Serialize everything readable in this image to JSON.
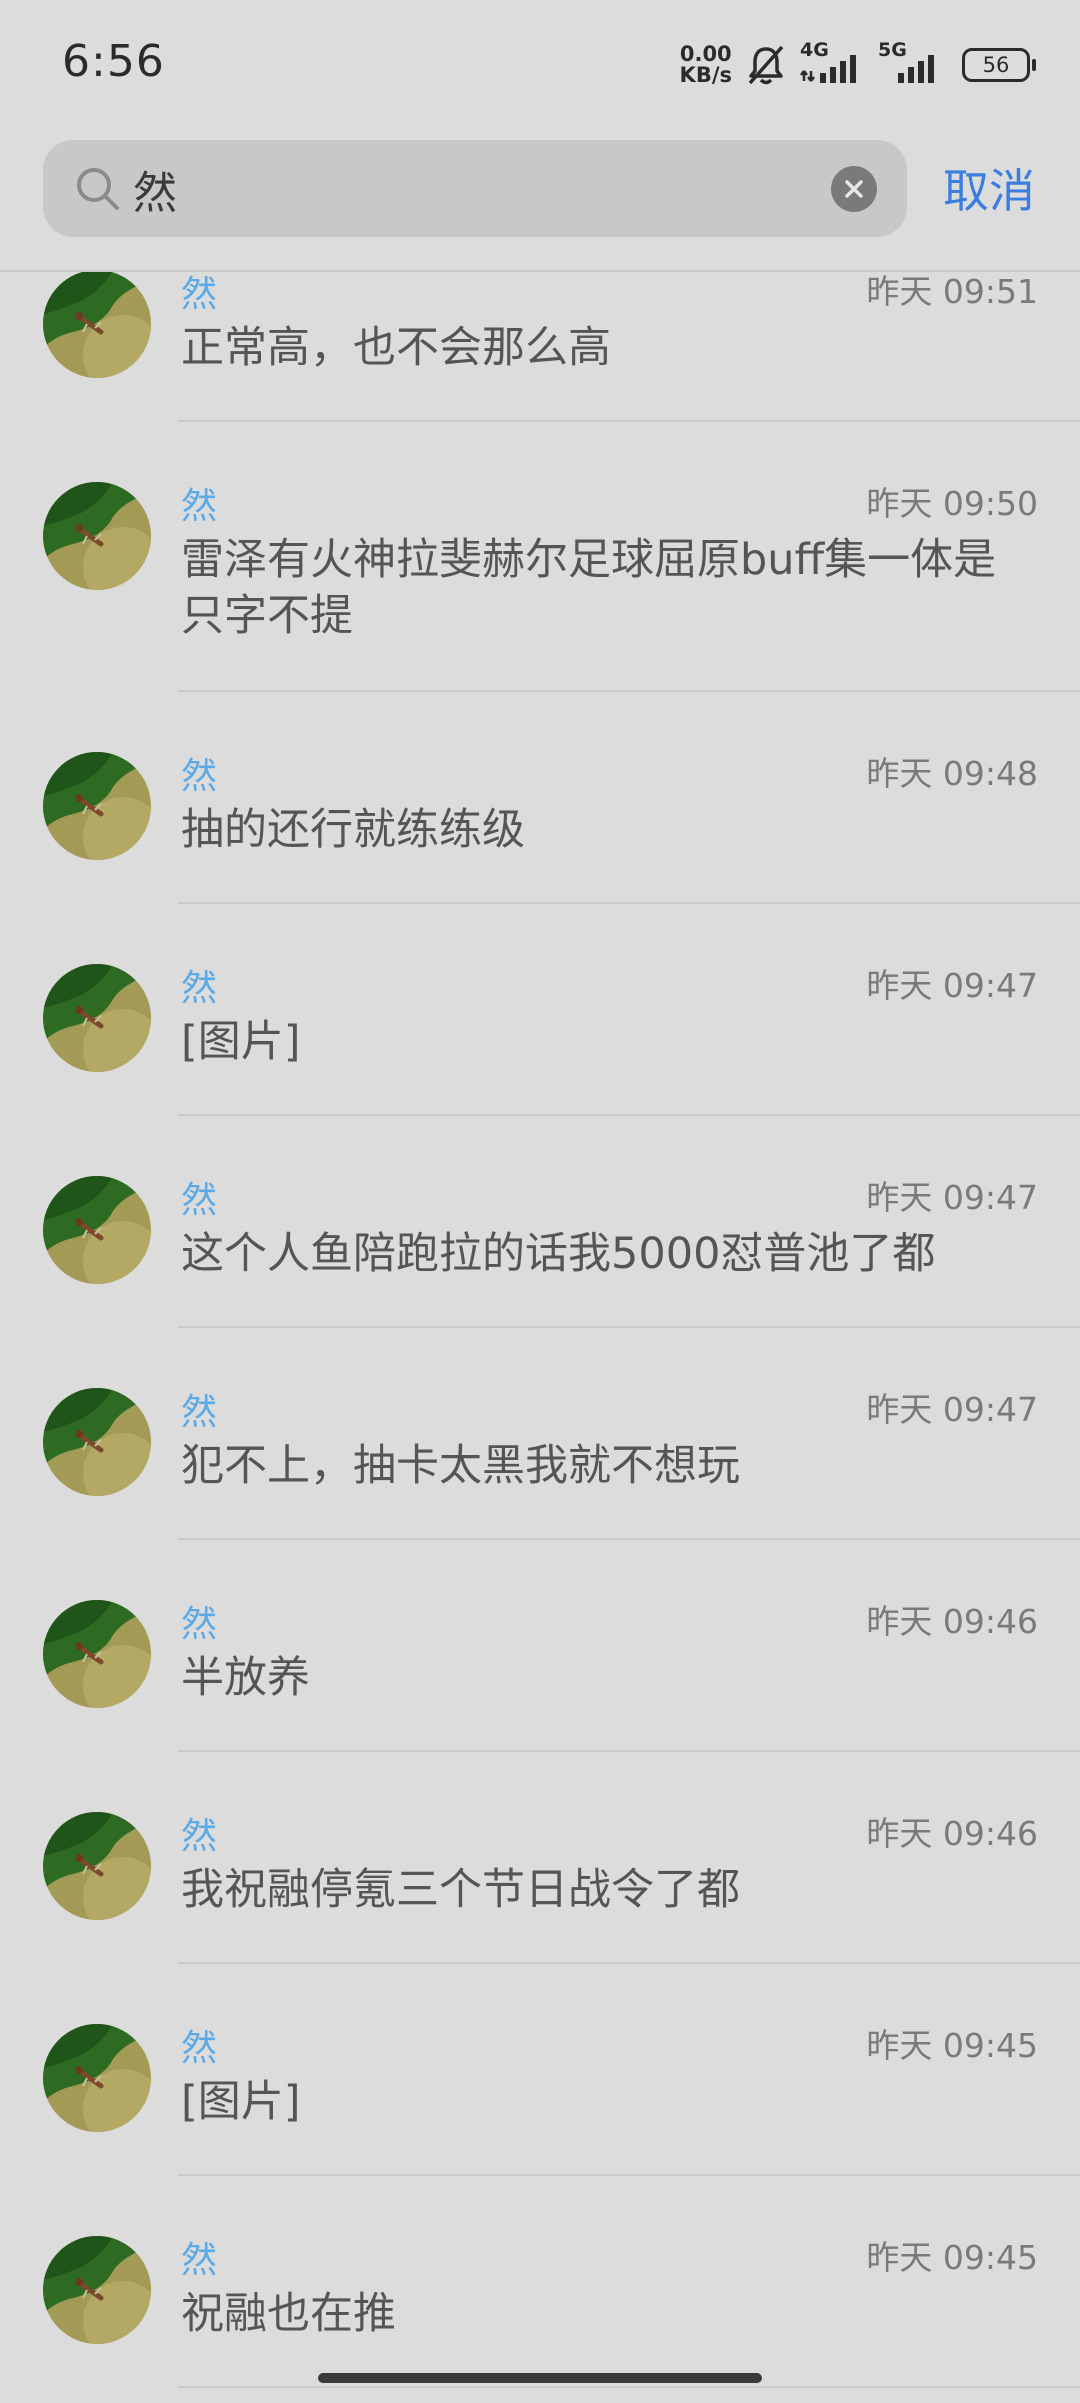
{
  "status_bar": {
    "time": "6:56",
    "net_speed_value": "0.00",
    "net_speed_unit": "KB/s",
    "signal_1_label": "4G",
    "signal_2_label": "5G",
    "battery": "56"
  },
  "search": {
    "query": "然",
    "cancel_label": "取消"
  },
  "results": [
    {
      "sender": "然",
      "time": "昨天 09:51",
      "message": "正常高，也不会那么高"
    },
    {
      "sender": "然",
      "time": "昨天 09:50",
      "message": "雷泽有火神拉斐赫尔足球屈原buff集一体是只字不提"
    },
    {
      "sender": "然",
      "time": "昨天 09:48",
      "message": "抽的还行就练练级"
    },
    {
      "sender": "然",
      "time": "昨天 09:47",
      "message": "[图片]"
    },
    {
      "sender": "然",
      "time": "昨天 09:47",
      "message": "这个人鱼陪跑拉的话我5000怼普池了都"
    },
    {
      "sender": "然",
      "time": "昨天 09:47",
      "message": "犯不上，抽卡太黑我就不想玩"
    },
    {
      "sender": "然",
      "time": "昨天 09:46",
      "message": "半放养"
    },
    {
      "sender": "然",
      "time": "昨天 09:46",
      "message": "我祝融停氪三个节日战令了都"
    },
    {
      "sender": "然",
      "time": "昨天 09:45",
      "message": "[图片]"
    },
    {
      "sender": "然",
      "time": "昨天 09:45",
      "message": "祝融也在推"
    }
  ]
}
